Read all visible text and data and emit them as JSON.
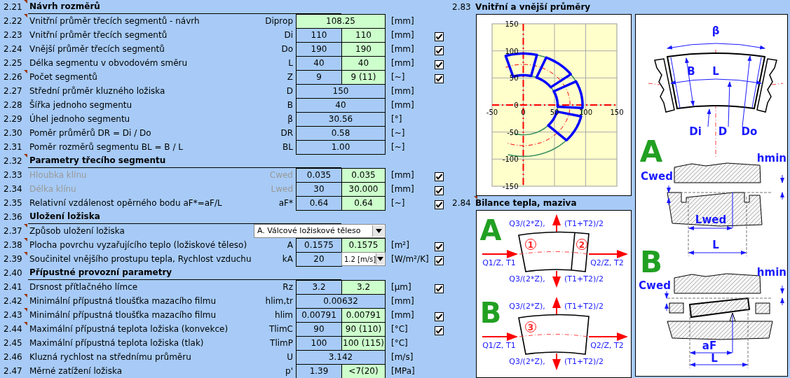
{
  "sections": [
    {
      "number": "2.21",
      "title": "Návrh rozměrů",
      "note": true,
      "rows": [
        {
          "number": "2.22",
          "label": "Vnitřní průměr třecích segmentů - návrh",
          "symbol": "Diprop",
          "kind": "single",
          "cells": [
            {
              "kind": "value",
              "text": "108.25",
              "editable": true
            }
          ],
          "unit": "[mm]",
          "note": true,
          "disabled": false
        },
        {
          "number": "2.23",
          "label": "Vnitřní průměr třecích segmentů",
          "symbol": "Di",
          "kind": "pair",
          "cells": [
            {
              "kind": "value",
              "text": "110",
              "editable": false
            },
            {
              "kind": "value",
              "text": "110",
              "editable": true
            }
          ],
          "unit": "[mm]",
          "checkbox": {
            "checked": true
          },
          "note": false,
          "disabled": false
        },
        {
          "number": "2.24",
          "label": "Vnější průměr třecích segmentů",
          "symbol": "Do",
          "kind": "pair",
          "cells": [
            {
              "kind": "value",
              "text": "190",
              "editable": false
            },
            {
              "kind": "value",
              "text": "190",
              "editable": true
            }
          ],
          "unit": "[mm]",
          "checkbox": {
            "checked": true
          },
          "note": false,
          "disabled": false
        },
        {
          "number": "2.25",
          "label": "Délka segmentu v obvodovém směru",
          "symbol": "L",
          "kind": "pair",
          "cells": [
            {
              "kind": "value",
              "text": "40",
              "editable": false
            },
            {
              "kind": "value",
              "text": "40",
              "editable": true
            }
          ],
          "unit": "[mm]",
          "checkbox": {
            "checked": true
          },
          "note": false,
          "disabled": false
        },
        {
          "number": "2.26",
          "label": "Počet segmentů",
          "symbol": "Z",
          "kind": "pair",
          "cells": [
            {
              "kind": "value",
              "text": "9",
              "editable": false
            },
            {
              "kind": "value",
              "text": "9  (11)",
              "editable": true
            }
          ],
          "unit": "[~]",
          "checkbox": {
            "checked": true
          },
          "note": true,
          "disabled": false
        },
        {
          "number": "2.27",
          "label": "Střední průměr kluzného ložiska",
          "symbol": "D",
          "kind": "single",
          "cells": [
            {
              "kind": "value",
              "text": "150",
              "editable": false
            }
          ],
          "unit": "[mm]",
          "note": false,
          "disabled": false
        },
        {
          "number": "2.28",
          "label": "Šířka jednoho segmentu",
          "symbol": "B",
          "kind": "single",
          "cells": [
            {
              "kind": "value",
              "text": "40",
              "editable": false
            }
          ],
          "unit": "[mm]",
          "note": false,
          "disabled": false
        },
        {
          "number": "2.29",
          "label": "Úhel jednoho segmentu",
          "symbol": "β",
          "kind": "single",
          "cells": [
            {
              "kind": "value",
              "text": "30.56",
              "editable": false
            }
          ],
          "unit": "[°]",
          "note": false,
          "disabled": false
        },
        {
          "number": "2.30",
          "label": "Poměr průměrů DR = Di / Do",
          "symbol": "DR",
          "kind": "single",
          "cells": [
            {
              "kind": "value",
              "text": "0.58",
              "editable": false
            }
          ],
          "unit": "[~]",
          "note": false,
          "disabled": false
        },
        {
          "number": "2.31",
          "label": "Poměr rozměrů segmentu BL = B / L",
          "symbol": "BL",
          "kind": "single",
          "cells": [
            {
              "kind": "value",
              "text": "1.00",
              "editable": false
            }
          ],
          "unit": "[~]",
          "note": false,
          "disabled": false
        }
      ]
    },
    {
      "number": "2.32",
      "title": "Parametry třecího segmentu",
      "note": true,
      "rows": [
        {
          "number": "2.33",
          "label": "Hloubka klínu",
          "symbol": "Cwed",
          "kind": "pair",
          "cells": [
            {
              "kind": "value",
              "text": "0.035",
              "editable": false
            },
            {
              "kind": "value",
              "text": "0.035",
              "editable": true
            }
          ],
          "unit": "[mm]",
          "checkbox": {
            "checked": true
          },
          "note": false,
          "disabled": true
        },
        {
          "number": "2.34",
          "label": "Délka klínu",
          "symbol": "Lwed",
          "kind": "pair",
          "cells": [
            {
              "kind": "value",
              "text": "30",
              "editable": false
            },
            {
              "kind": "value",
              "text": "30.000",
              "editable": true
            }
          ],
          "unit": "[mm]",
          "checkbox": {
            "checked": true
          },
          "note": false,
          "disabled": true
        },
        {
          "number": "2.35",
          "label": "Relativní vzdálenost opěrného bodu aF*=aF/L",
          "symbol": "aF*",
          "kind": "pair",
          "cells": [
            {
              "kind": "value",
              "text": "0.64",
              "editable": false
            },
            {
              "kind": "value",
              "text": "0.64",
              "editable": true
            }
          ],
          "unit": "[~]",
          "checkbox": {
            "checked": true
          },
          "note": false,
          "disabled": false
        }
      ]
    },
    {
      "number": "2.36",
      "title": "Uložení ložiska",
      "note": false,
      "rows": [
        {
          "number": "2.37",
          "label": "Způsob uložení ložiska",
          "kind": "choice",
          "cells": [
            {
              "kind": "dropdown",
              "text": "A. Válcové ložiskové těleso"
            }
          ],
          "note": true,
          "disabled": false
        },
        {
          "number": "2.38",
          "label": "Plocha povrchu vyzařujícího teplo (ložiskové těleso)",
          "symbol": "A",
          "kind": "pair",
          "cells": [
            {
              "kind": "value",
              "text": "0.1575",
              "editable": false
            },
            {
              "kind": "value",
              "text": "0.1575",
              "editable": true
            }
          ],
          "unit": "[m²]",
          "checkbox": {
            "checked": true
          },
          "note": true,
          "disabled": false
        },
        {
          "number": "2.39",
          "label": "Součinitel vnějšího prostupu tepla, Rychlost vzduchu",
          "symbol": "kA",
          "kind": "pair",
          "cells": [
            {
              "kind": "value",
              "text": "20",
              "editable": false
            },
            {
              "kind": "dropdown",
              "text": "1.2 [m/s]"
            }
          ],
          "unit": "[W/m²/K]",
          "checkbox": {
            "checked": true
          },
          "note": true,
          "disabled": false
        }
      ]
    },
    {
      "number": "2.40",
      "title": "Přípustné provozní parametry",
      "note": false,
      "rows": [
        {
          "number": "2.41",
          "label": "Drsnost přítlačného límce",
          "symbol": "Rz",
          "kind": "pair",
          "cells": [
            {
              "kind": "value",
              "text": "3.2",
              "editable": false
            },
            {
              "kind": "value",
              "text": "3.2",
              "editable": true
            }
          ],
          "unit": "[µm]",
          "checkbox": {
            "checked": true
          },
          "note": false,
          "disabled": false
        },
        {
          "number": "2.42",
          "label": "Minimální přípustná tloušťka mazacího filmu",
          "symbol": "hlim,tr",
          "kind": "single",
          "cells": [
            {
              "kind": "value",
              "text": "0.00632",
              "editable": false
            }
          ],
          "unit": "[mm]",
          "note": true,
          "disabled": false
        },
        {
          "number": "2.43",
          "label": "Minimální přípustná tloušťka mazacího filmu",
          "symbol": "hlim",
          "kind": "pair",
          "cells": [
            {
              "kind": "value",
              "text": "0.00791",
              "editable": false
            },
            {
              "kind": "value",
              "text": "0.00791",
              "editable": true
            }
          ],
          "unit": "[mm]",
          "checkbox": {
            "checked": true
          },
          "note": true,
          "disabled": false
        },
        {
          "number": "2.44",
          "label": "Maximální přípustná teplota ložiska (konvekce)",
          "symbol": "TlimC",
          "kind": "pair",
          "cells": [
            {
              "kind": "value",
              "text": "90",
              "editable": false
            },
            {
              "kind": "value",
              "text": "90 (110)",
              "editable": true
            }
          ],
          "unit": "[°C]",
          "checkbox": {
            "checked": true
          },
          "note": true,
          "disabled": false
        },
        {
          "number": "2.45",
          "label": "Maximální přípustná teplota ložiska (tlak)",
          "symbol": "TlimP",
          "kind": "pair",
          "cells": [
            {
              "kind": "value",
              "text": "100",
              "editable": false
            },
            {
              "kind": "value",
              "text": "100 (115)",
              "editable": true
            }
          ],
          "unit": "[°C]",
          "note": false,
          "disabled": false
        },
        {
          "number": "2.46",
          "label": "Kluzná rychlost na střednímu průměru",
          "symbol": "U",
          "kind": "single",
          "cells": [
            {
              "kind": "value",
              "text": "3.142",
              "editable": false
            }
          ],
          "unit": "[m/s]",
          "note": false,
          "disabled": false
        },
        {
          "number": "2.47",
          "label": "Měrné zatížení ložiska",
          "symbol": "p'",
          "kind": "pair",
          "cells": [
            {
              "kind": "value",
              "text": "1.39",
              "editable": false
            },
            {
              "kind": "value",
              "text": "<7(20)",
              "editable": true
            }
          ],
          "unit": "[MPa]",
          "note": false,
          "disabled": false
        }
      ]
    }
  ],
  "diameters_chart": {
    "number": "2.83",
    "title": "Vnitřní a vnější průměry",
    "x_ticks": [
      "-50",
      "0",
      "50",
      "100",
      "150"
    ],
    "y_ticks": [
      "150",
      "100",
      "50",
      "0",
      "-50",
      "-100",
      "-150"
    ]
  },
  "heat_balance": {
    "number": "2.84",
    "title": "Bilance tepla, maziva",
    "note": true,
    "variants": [
      {
        "letter": "A",
        "top_flow": "Q3/(2*Z),",
        "top_temp": "(T1+T2)/2",
        "zones": [
          "1",
          "2"
        ],
        "inlet": "Q1/Z, T1",
        "outlet": "Q2/Z, T2",
        "bottom_flow": "Q3/(2*Z),",
        "bottom_temp": "(T1+T2)/2"
      },
      {
        "letter": "B",
        "top_flow": "Q3/(2*Z),",
        "top_temp": "(T1+T2)/2",
        "zones": [
          "3"
        ],
        "inlet": "Q1/Z, T1",
        "outlet": "Q2/Z, T2",
        "bottom_flow": "Q3/(2*Z),",
        "bottom_temp": "(T1+T2)/2"
      }
    ]
  },
  "sketch": {
    "angle": "β",
    "width": "B",
    "length": "L",
    "inner_diameter": "Di",
    "mean_diameter": "D",
    "outer_diameter": "Do",
    "variants": [
      {
        "kind": "wedge",
        "letter": "A",
        "wedge_depth": "Cwed",
        "min_film": "hmin",
        "dimension": "Lwed",
        "length": "L"
      },
      {
        "kind": "tilting",
        "letter": "B",
        "wedge_depth": "Cwed",
        "min_film": "hmin",
        "dimension": "aF",
        "length": "L"
      }
    ]
  }
}
